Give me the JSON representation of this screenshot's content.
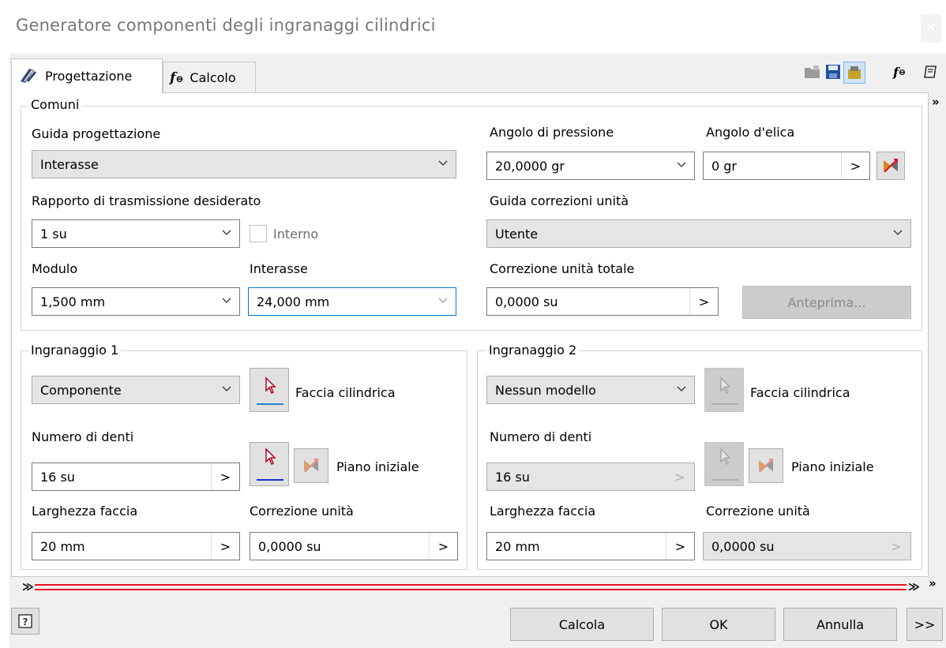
{
  "window": {
    "title": "Generatore componenti degli ingranaggi cilindrici"
  },
  "tabs": [
    {
      "label": "Progettazione",
      "icon": "design-pencil-icon",
      "active": true
    },
    {
      "label": "Calcolo",
      "icon": "fx-icon",
      "active": false
    }
  ],
  "toolbar_icons": [
    "open-folder-icon",
    "save-icon",
    "options-icon",
    "fx-icon",
    "help-book-icon"
  ],
  "comuni": {
    "legend": "Comuni",
    "guida_progettazione": {
      "label": "Guida progettazione",
      "value": "Interasse"
    },
    "rapporto": {
      "label": "Rapporto di trasmissione desiderato",
      "value": "1 su"
    },
    "interno": {
      "label": "Interno",
      "checked": false
    },
    "modulo": {
      "label": "Modulo",
      "value": "1,500 mm"
    },
    "interasse": {
      "label": "Interasse",
      "value": "24,000 mm"
    },
    "angolo_pressione": {
      "label": "Angolo di pressione",
      "value": "20,0000 gr"
    },
    "angolo_elica": {
      "label": "Angolo d'elica",
      "value": "0 gr"
    },
    "guida_correzioni": {
      "label": "Guida correzioni unità",
      "value": "Utente"
    },
    "correzione_totale": {
      "label": "Correzione unità totale",
      "value": "0,0000 su"
    },
    "anteprima": "Anteprima..."
  },
  "gear1": {
    "legend": "Ingranaggio 1",
    "type": "Componente",
    "faccia": "Faccia cilindrica",
    "teeth_label": "Numero di denti",
    "teeth": "16 su",
    "piano": "Piano iniziale",
    "width_label": "Larghezza faccia",
    "width": "20 mm",
    "corr_label": "Correzione unità",
    "corr": "0,0000 su"
  },
  "gear2": {
    "legend": "Ingranaggio 2",
    "type": "Nessun modello",
    "faccia": "Faccia cilindrica",
    "teeth_label": "Numero di denti",
    "teeth": "16 su",
    "piano": "Piano iniziale",
    "width_label": "Larghezza faccia",
    "width": "20 mm",
    "corr_label": "Correzione unità",
    "corr": "0,0000 su"
  },
  "footer": {
    "calcola": "Calcola",
    "ok": "OK",
    "annulla": "Annulla",
    "more": ">>"
  },
  "colors": {
    "accent": "#0078d7",
    "red_line": "#e81123",
    "dialog_bg": "#f0f0f0"
  }
}
